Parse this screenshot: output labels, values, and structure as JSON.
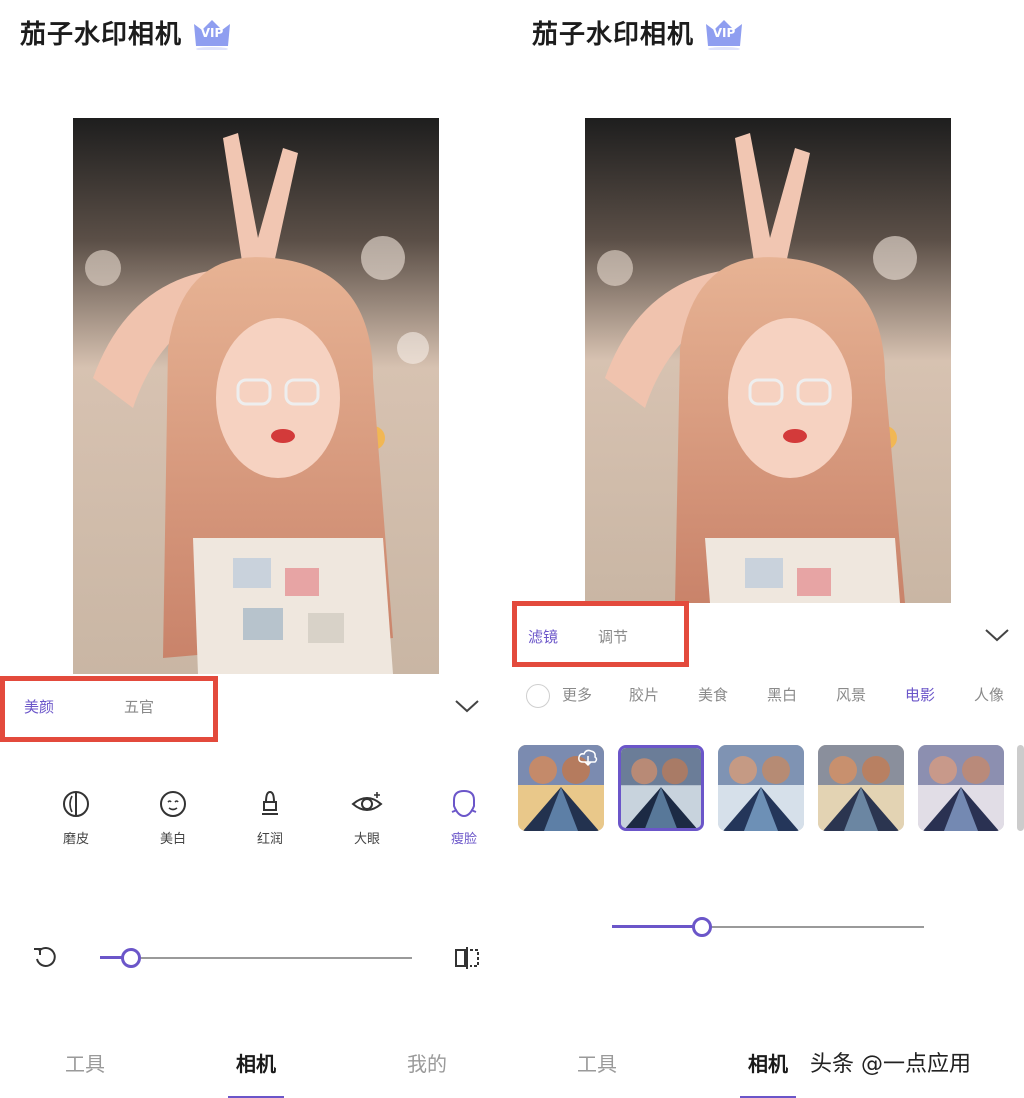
{
  "app": {
    "title": "茄子水印相机",
    "vip_label": "VIP"
  },
  "left_panel": {
    "tabs": [
      {
        "label": "美颜",
        "active": true
      },
      {
        "label": "五官",
        "active": false
      }
    ],
    "tools": [
      {
        "label": "磨皮",
        "icon": "smooth-skin-icon",
        "active": false
      },
      {
        "label": "美白",
        "icon": "whitening-face-icon",
        "active": false
      },
      {
        "label": "红润",
        "icon": "rosy-lipstick-icon",
        "active": false
      },
      {
        "label": "大眼",
        "icon": "big-eye-icon",
        "active": false
      },
      {
        "label": "瘦脸",
        "icon": "slim-face-icon",
        "active": true
      }
    ],
    "slider_value": 0.1,
    "reset_icon": "reset-icon",
    "compare_icon": "compare-icon"
  },
  "right_panel": {
    "tabs": [
      {
        "label": "滤镜",
        "active": true
      },
      {
        "label": "调节",
        "active": false
      }
    ],
    "filter_categories": [
      {
        "label": "更多",
        "active": false
      },
      {
        "label": "胶片",
        "active": false
      },
      {
        "label": "美食",
        "active": false
      },
      {
        "label": "黑白",
        "active": false
      },
      {
        "label": "风景",
        "active": false
      },
      {
        "label": "电影",
        "active": true
      },
      {
        "label": "人像",
        "active": false
      }
    ],
    "thumbnails_count_visible": 5,
    "selected_thumbnail": 2,
    "slider_value": 0.29
  },
  "nav": [
    {
      "label": "工具",
      "active": false
    },
    {
      "label": "相机",
      "active": true
    },
    {
      "label": "我的",
      "active": false
    }
  ],
  "watermark": "头条 @一点应用",
  "colors": {
    "accent": "#6b56c9",
    "highlight": "#e34a3c"
  }
}
